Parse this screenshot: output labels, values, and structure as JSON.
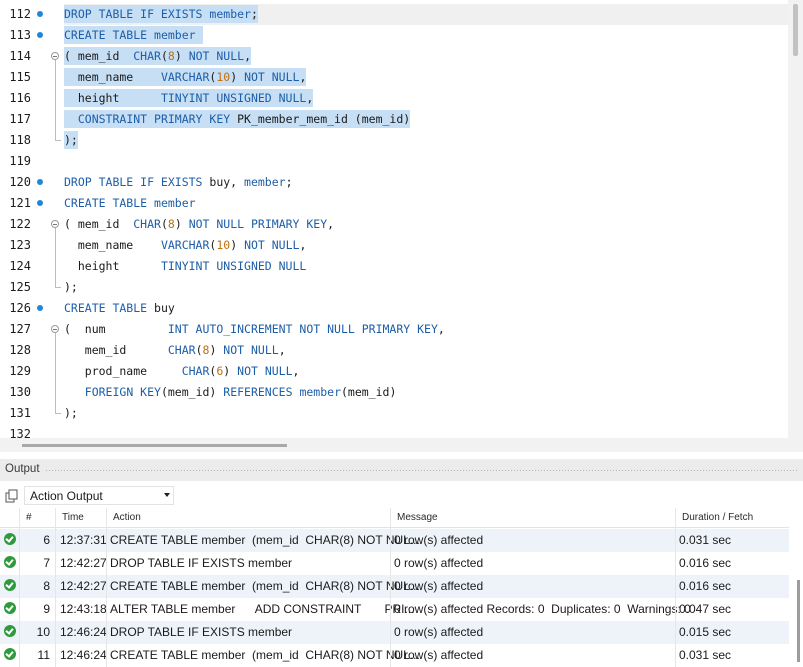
{
  "editor": {
    "lines": [
      {
        "n": "112",
        "dot": true,
        "fold": "none",
        "html": "<span class=\"sel\"><span class=\"kw\">DROP TABLE IF EXISTS</span> <span class=\"kw\">member</span>;</span>"
      },
      {
        "n": "113",
        "dot": true,
        "fold": "none",
        "html": "<span class=\"sel\"><span class=\"kw\">CREATE TABLE</span> <span class=\"kw\">member</span> </span>"
      },
      {
        "n": "114",
        "dot": false,
        "fold": "start",
        "html": "<span class=\"sel\">( mem_id  <span class=\"kw\">CHAR</span>(<span class=\"num\">8</span>) <span class=\"kw\">NOT NULL</span>,</span>"
      },
      {
        "n": "115",
        "dot": false,
        "fold": "mid",
        "html": "<span class=\"sel\">  mem_name    <span class=\"kw\">VARCHAR</span>(<span class=\"num\">10</span>) <span class=\"kw\">NOT NULL</span>,</span>"
      },
      {
        "n": "116",
        "dot": false,
        "fold": "mid",
        "html": "<span class=\"sel\">  height      <span class=\"kw\">TINYINT UNSIGNED NULL</span>,</span>"
      },
      {
        "n": "117",
        "dot": false,
        "fold": "mid",
        "html": "<span class=\"sel\">  <span class=\"kw\">CONSTRAINT PRIMARY KEY</span> PK_member_mem_id (mem_id)</span>"
      },
      {
        "n": "118",
        "dot": false,
        "fold": "end",
        "html": "<span class=\"sel\">);</span>"
      },
      {
        "n": "119",
        "dot": false,
        "fold": "none",
        "html": ""
      },
      {
        "n": "120",
        "dot": true,
        "fold": "none",
        "html": "<span class=\"kw\">DROP TABLE IF EXISTS</span> buy, <span class=\"kw\">member</span>;"
      },
      {
        "n": "121",
        "dot": true,
        "fold": "none",
        "html": "<span class=\"kw\">CREATE TABLE</span> <span class=\"kw\">member</span>"
      },
      {
        "n": "122",
        "dot": false,
        "fold": "start",
        "html": "( mem_id  <span class=\"kw\">CHAR</span>(<span class=\"num\">8</span>) <span class=\"kw\">NOT NULL PRIMARY KEY</span>,"
      },
      {
        "n": "123",
        "dot": false,
        "fold": "mid",
        "html": "  mem_name    <span class=\"kw\">VARCHAR</span>(<span class=\"num\">10</span>) <span class=\"kw\">NOT NULL</span>,"
      },
      {
        "n": "124",
        "dot": false,
        "fold": "mid",
        "html": "  height      <span class=\"kw\">TINYINT UNSIGNED NULL</span>"
      },
      {
        "n": "125",
        "dot": false,
        "fold": "end",
        "html": ");"
      },
      {
        "n": "126",
        "dot": true,
        "fold": "none",
        "html": "<span class=\"kw\">CREATE TABLE</span> buy"
      },
      {
        "n": "127",
        "dot": false,
        "fold": "start",
        "html": "(  num         <span class=\"kw\">INT AUTO_INCREMENT NOT NULL PRIMARY KEY</span>,"
      },
      {
        "n": "128",
        "dot": false,
        "fold": "mid",
        "html": "   mem_id      <span class=\"kw\">CHAR</span>(<span class=\"num\">8</span>) <span class=\"kw\">NOT NULL</span>,"
      },
      {
        "n": "129",
        "dot": false,
        "fold": "mid",
        "html": "   prod_name     <span class=\"kw\">CHAR</span>(<span class=\"num\">6</span>) <span class=\"kw\">NOT NULL</span>,"
      },
      {
        "n": "130",
        "dot": false,
        "fold": "mid",
        "html": "   <span class=\"kw\">FOREIGN KEY</span>(mem_id) <span class=\"kw\">REFERENCES</span> <span class=\"kw\">member</span>(mem_id)"
      },
      {
        "n": "131",
        "dot": false,
        "fold": "end",
        "html": ");"
      },
      {
        "n": "132",
        "dot": false,
        "fold": "none",
        "html": ""
      }
    ]
  },
  "output": {
    "title": "Output",
    "action_select": "Action Output",
    "columns": {
      "num": "#",
      "time": "Time",
      "action": "Action",
      "message": "Message",
      "duration": "Duration / Fetch"
    },
    "rows": [
      {
        "num": "6",
        "time": "12:37:31",
        "action": "CREATE TABLE member  (mem_id  CHAR(8) NOT NUL...",
        "message": "0 row(s) affected",
        "duration": "0.031 sec"
      },
      {
        "num": "7",
        "time": "12:42:27",
        "action": "DROP TABLE IF EXISTS member",
        "message": "0 row(s) affected",
        "duration": "0.016 sec"
      },
      {
        "num": "8",
        "time": "12:42:27",
        "action": "CREATE TABLE member  (mem_id  CHAR(8) NOT NUL...",
        "message": "0 row(s) affected",
        "duration": "0.016 sec"
      },
      {
        "num": "9",
        "time": "12:43:18",
        "action": "ALTER TABLE member      ADD CONSTRAINT       PRI...",
        "message": "0 row(s) affected Records: 0  Duplicates: 0  Warnings: 0",
        "duration": "0.047 sec"
      },
      {
        "num": "10",
        "time": "12:46:24",
        "action": "DROP TABLE IF EXISTS member",
        "message": "0 row(s) affected",
        "duration": "0.015 sec"
      },
      {
        "num": "11",
        "time": "12:46:24",
        "action": "CREATE TABLE member  (mem_id  CHAR(8) NOT NUL...",
        "message": "0 row(s) affected",
        "duration": "0.031 sec"
      }
    ]
  }
}
